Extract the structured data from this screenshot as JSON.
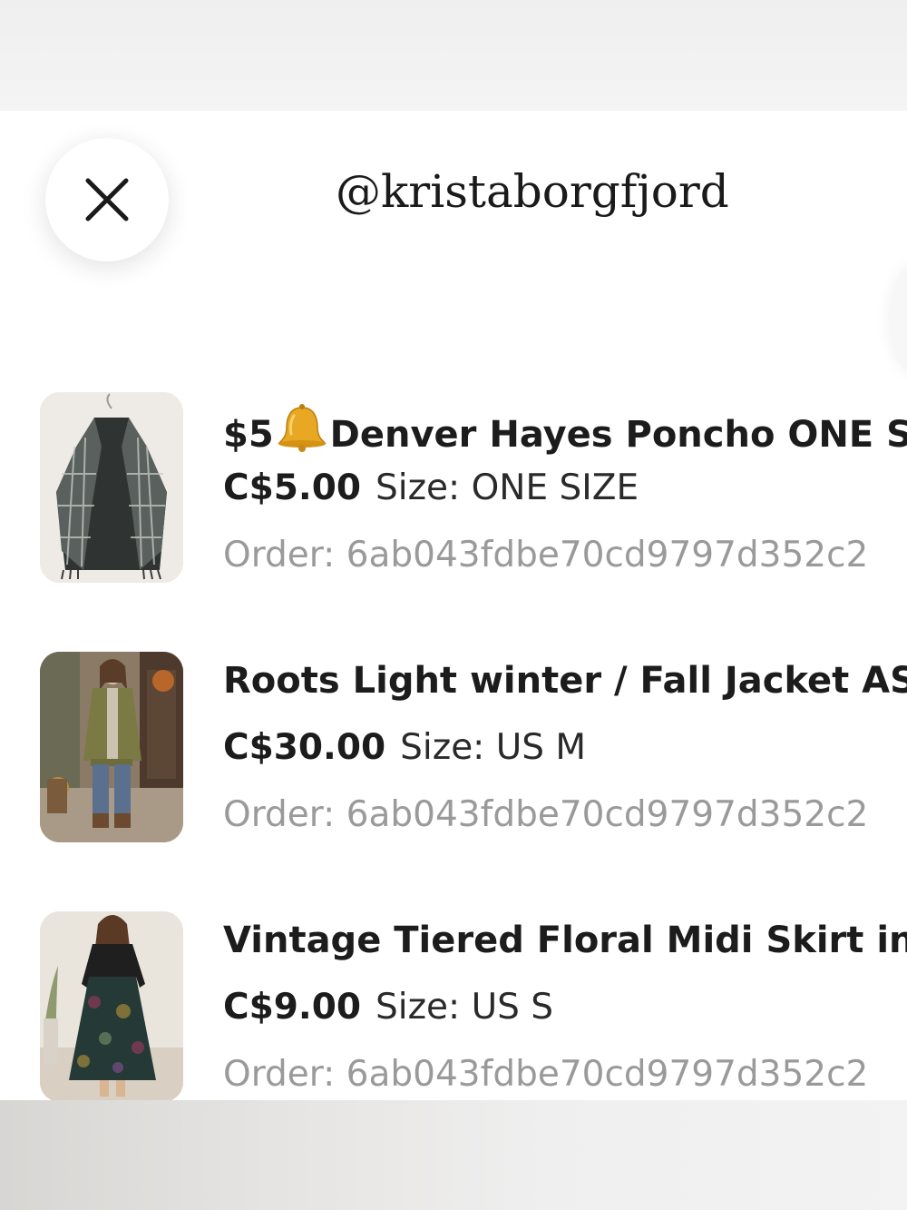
{
  "header": {
    "title": "@kristaborgfjord"
  },
  "orders": [
    {
      "title_prefix": "$5",
      "title_icon": "bell-icon",
      "title": "Denver Hayes Poncho ONE SIZE",
      "price": "C$5.00",
      "size": "Size: ONE SIZE",
      "order": "Order: 6ab043fdbe70cd9797d352c2"
    },
    {
      "title": "Roots Light winter / Fall Jacket AS IS",
      "price": "C$30.00",
      "size": "Size: US M",
      "order": "Order: 6ab043fdbe70cd9797d352c2"
    },
    {
      "title": "Vintage Tiered Floral Midi Skirt in Green",
      "price": "C$9.00",
      "size": "Size: US S",
      "order": "Order: 6ab043fdbe70cd9797d352c2"
    }
  ],
  "icons": {
    "close": "close-icon",
    "bell": "bell-icon"
  },
  "colors": {
    "text": "#1c1c1c",
    "muted": "#9a9a9a",
    "bell": "#e8a824"
  }
}
